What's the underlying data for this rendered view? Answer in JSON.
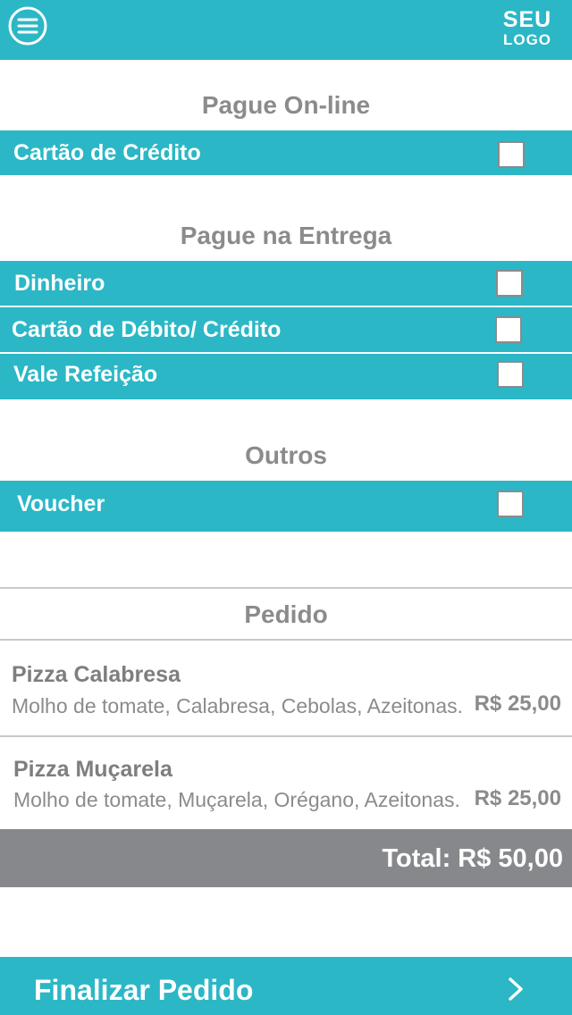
{
  "header": {
    "menu_icon": "hamburger-menu-icon",
    "logo_line1": "SEU",
    "logo_line2": "LOGO"
  },
  "online": {
    "title": "Pague On-line",
    "options": [
      {
        "label": "Cartão de Crédito",
        "checked": false
      }
    ]
  },
  "delivery": {
    "title": "Pague na Entrega",
    "options": [
      {
        "label": "Dinheiro",
        "checked": false
      },
      {
        "label": "Cartão de Débito/ Crédito",
        "checked": false
      },
      {
        "label": "Vale Refeição",
        "checked": false
      }
    ]
  },
  "others": {
    "title": "Outros",
    "options": [
      {
        "label": "Voucher",
        "checked": false
      }
    ]
  },
  "order": {
    "title": "Pedido",
    "items": [
      {
        "name": "Pizza Calabresa",
        "description": "Molho de tomate, Calabresa, Cebolas, Azeitonas.",
        "price": "R$ 25,00"
      },
      {
        "name": "Pizza Muçarela",
        "description": "Molho de tomate, Muçarela, Orégano, Azeitonas.",
        "price": "R$ 25,00"
      }
    ],
    "total": "Total: R$ 50,00"
  },
  "footer": {
    "finalize_label": "Finalizar Pedido",
    "chevron_icon": "chevron-right-icon"
  },
  "colors": {
    "accent": "#2bb7c6",
    "gray_bar": "#87888b",
    "text_gray": "#8a8b8d",
    "background": "#ffffff"
  }
}
